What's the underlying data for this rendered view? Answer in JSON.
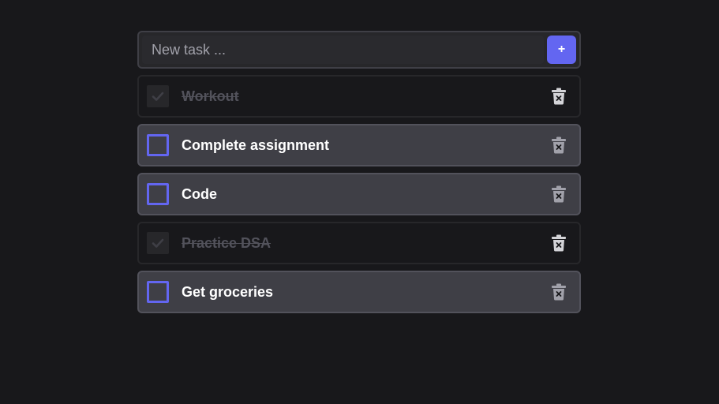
{
  "new_task": {
    "placeholder": "New task ...",
    "add_label": "+"
  },
  "tasks": [
    {
      "label": "Workout",
      "done": true
    },
    {
      "label": "Complete assignment",
      "done": false
    },
    {
      "label": "Code",
      "done": false
    },
    {
      "label": "Practice DSA",
      "done": true
    },
    {
      "label": "Get groceries",
      "done": false
    }
  ],
  "icons": {
    "check": "check-icon",
    "delete": "trash-icon"
  },
  "colors": {
    "accent": "#6366f1",
    "background": "#18181b",
    "open_task_bg": "#3f3f46",
    "done_text": "#52525b"
  }
}
